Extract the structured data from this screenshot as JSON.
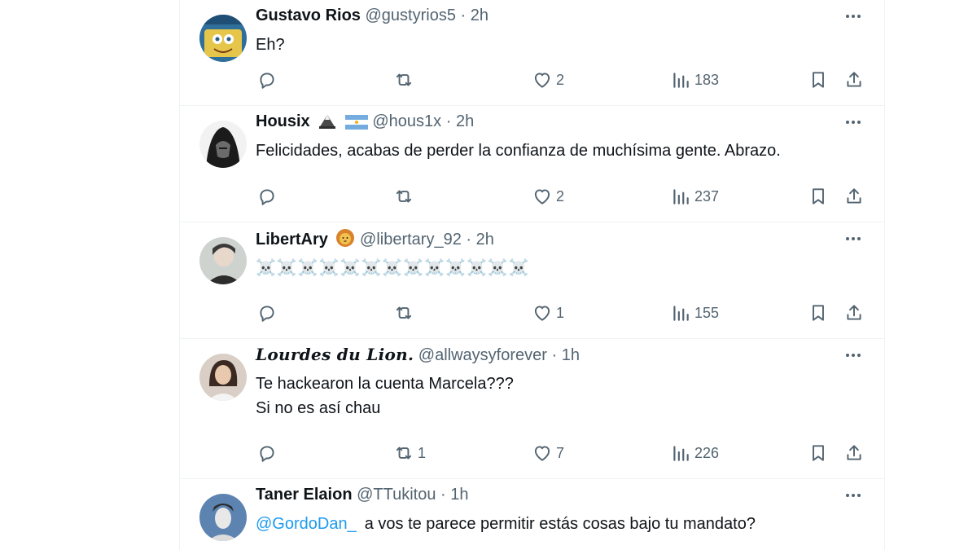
{
  "tweets": [
    {
      "name": "Gustavo Rios",
      "handle": "@gustyrios5",
      "separator": "·",
      "time": "2h",
      "text_lines": [
        "Eh?"
      ],
      "reply_count": "",
      "retweet_count": "",
      "like_count": "2",
      "view_count": "183",
      "badges": [],
      "avatar_colors": [
        "#e6c64a",
        "#2f6f9a"
      ]
    },
    {
      "name": "Housix",
      "handle": "@hous1x",
      "separator": "·",
      "time": "2h",
      "text_lines": [
        "Felicidades, acabas de perder la confianza de muchísima gente. Abrazo."
      ],
      "reply_count": "",
      "retweet_count": "",
      "like_count": "2",
      "view_count": "237",
      "badges": [
        "eagle-emoji",
        "argentina-flag-emoji"
      ],
      "avatar_colors": [
        "#1b1b1b",
        "#6b6b6b"
      ]
    },
    {
      "name": "LibertAry",
      "handle": "@libertary_92",
      "separator": "·",
      "time": "2h",
      "text_lines": [
        "☠️☠️☠️☠️☠️☠️☠️☠️☠️☠️☠️☠️☠️"
      ],
      "reply_count": "",
      "retweet_count": "",
      "like_count": "1",
      "view_count": "155",
      "badges": [
        "lion-emoji"
      ],
      "avatar_colors": [
        "#cfd3d0",
        "#3a3a3a"
      ]
    },
    {
      "name": "Lourdes du Lion.",
      "handle": "@allwaysyforever",
      "separator": "·",
      "time": "1h",
      "text_lines": [
        "Te hackearon la cuenta Marcela???",
        "Si no es así chau"
      ],
      "reply_count": "",
      "retweet_count": "1",
      "like_count": "7",
      "view_count": "226",
      "badges": [],
      "avatar_colors": [
        "#d9cfc6",
        "#3b2a22"
      ]
    },
    {
      "name": "Taner Elaion",
      "handle": "@TTukitou",
      "separator": "·",
      "time": "1h",
      "mention": "@GordoDan_",
      "text_lines": [
        "a vos te parece permitir estás cosas bajo tu mandato?"
      ],
      "badges": [],
      "avatar_colors": [
        "#5d83b0",
        "#e8e8e8"
      ]
    }
  ],
  "colors": {
    "text": "#0f1419",
    "secondary": "#536471",
    "link": "#1d9bf0",
    "divider": "#eff3f4"
  }
}
